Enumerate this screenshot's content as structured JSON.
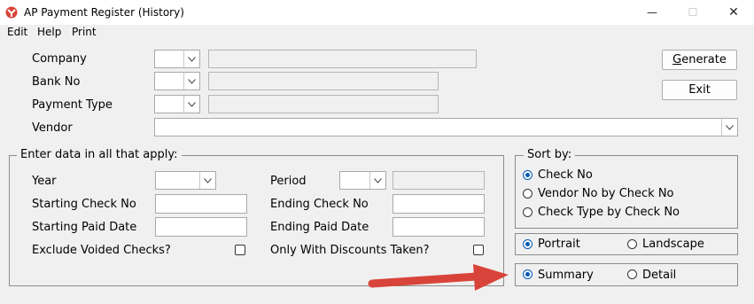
{
  "window": {
    "title": "AP Payment Register (History)",
    "controls": {
      "minimize": "—",
      "maximize": "☐",
      "close": "✕"
    }
  },
  "menu": [
    "Edit",
    "Help",
    "Print"
  ],
  "header": {
    "company_label": "Company",
    "bank_label": "Bank No",
    "payment_type_label": "Payment Type",
    "vendor_label": "Vendor"
  },
  "buttons": {
    "generate_prefix": "",
    "generate_underline": "G",
    "generate_rest": "enerate",
    "exit": "Exit"
  },
  "criteria": {
    "legend": "Enter data in all that apply:",
    "year_label": "Year",
    "period_label": "Period",
    "start_check_label": "Starting Check No",
    "end_check_label": "Ending Check No",
    "start_paid_label": "Starting Paid Date",
    "end_paid_label": "Ending Paid Date",
    "exclude_voided_label": "Exclude Voided Checks?",
    "only_discounts_label": "Only With Discounts Taken?",
    "exclude_voided_checked": false,
    "only_discounts_checked": false
  },
  "sort": {
    "legend": "Sort by:",
    "options": [
      "Check No",
      "Vendor No by Check No",
      "Check Type by Check No"
    ],
    "selected": "Check No"
  },
  "orientation": {
    "options": [
      "Portrait",
      "Landscape"
    ],
    "selected": "Portrait"
  },
  "detail_level": {
    "options": [
      "Summary",
      "Detail"
    ],
    "selected": "Summary"
  },
  "colors": {
    "accent": "#0058b8",
    "arrow": "#d9443a"
  }
}
